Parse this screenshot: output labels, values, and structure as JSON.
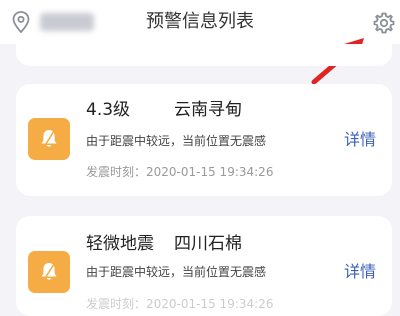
{
  "header": {
    "title": "预警信息列表",
    "location_icon": "location-pin-icon",
    "settings_icon": "gear-icon"
  },
  "colors": {
    "accent": "#3a62b7",
    "alert": "#f5ac45",
    "annotation_arrow": "#e02424"
  },
  "alerts": [
    {
      "magnitude": "4.3级",
      "place": "云南寻甸",
      "note": "由于距震中较远，当前位置无震感",
      "time": "发震时刻：2020-01-15 19:34:26",
      "detail_label": "详情",
      "icon": "bell-icon"
    },
    {
      "magnitude": "轻微地震",
      "place": "四川石棉",
      "note": "由于距震中较远，当前位置无震感",
      "time": "发震时刻：2020-01-15 19:34:26",
      "detail_label": "详情",
      "icon": "bell-icon"
    }
  ]
}
